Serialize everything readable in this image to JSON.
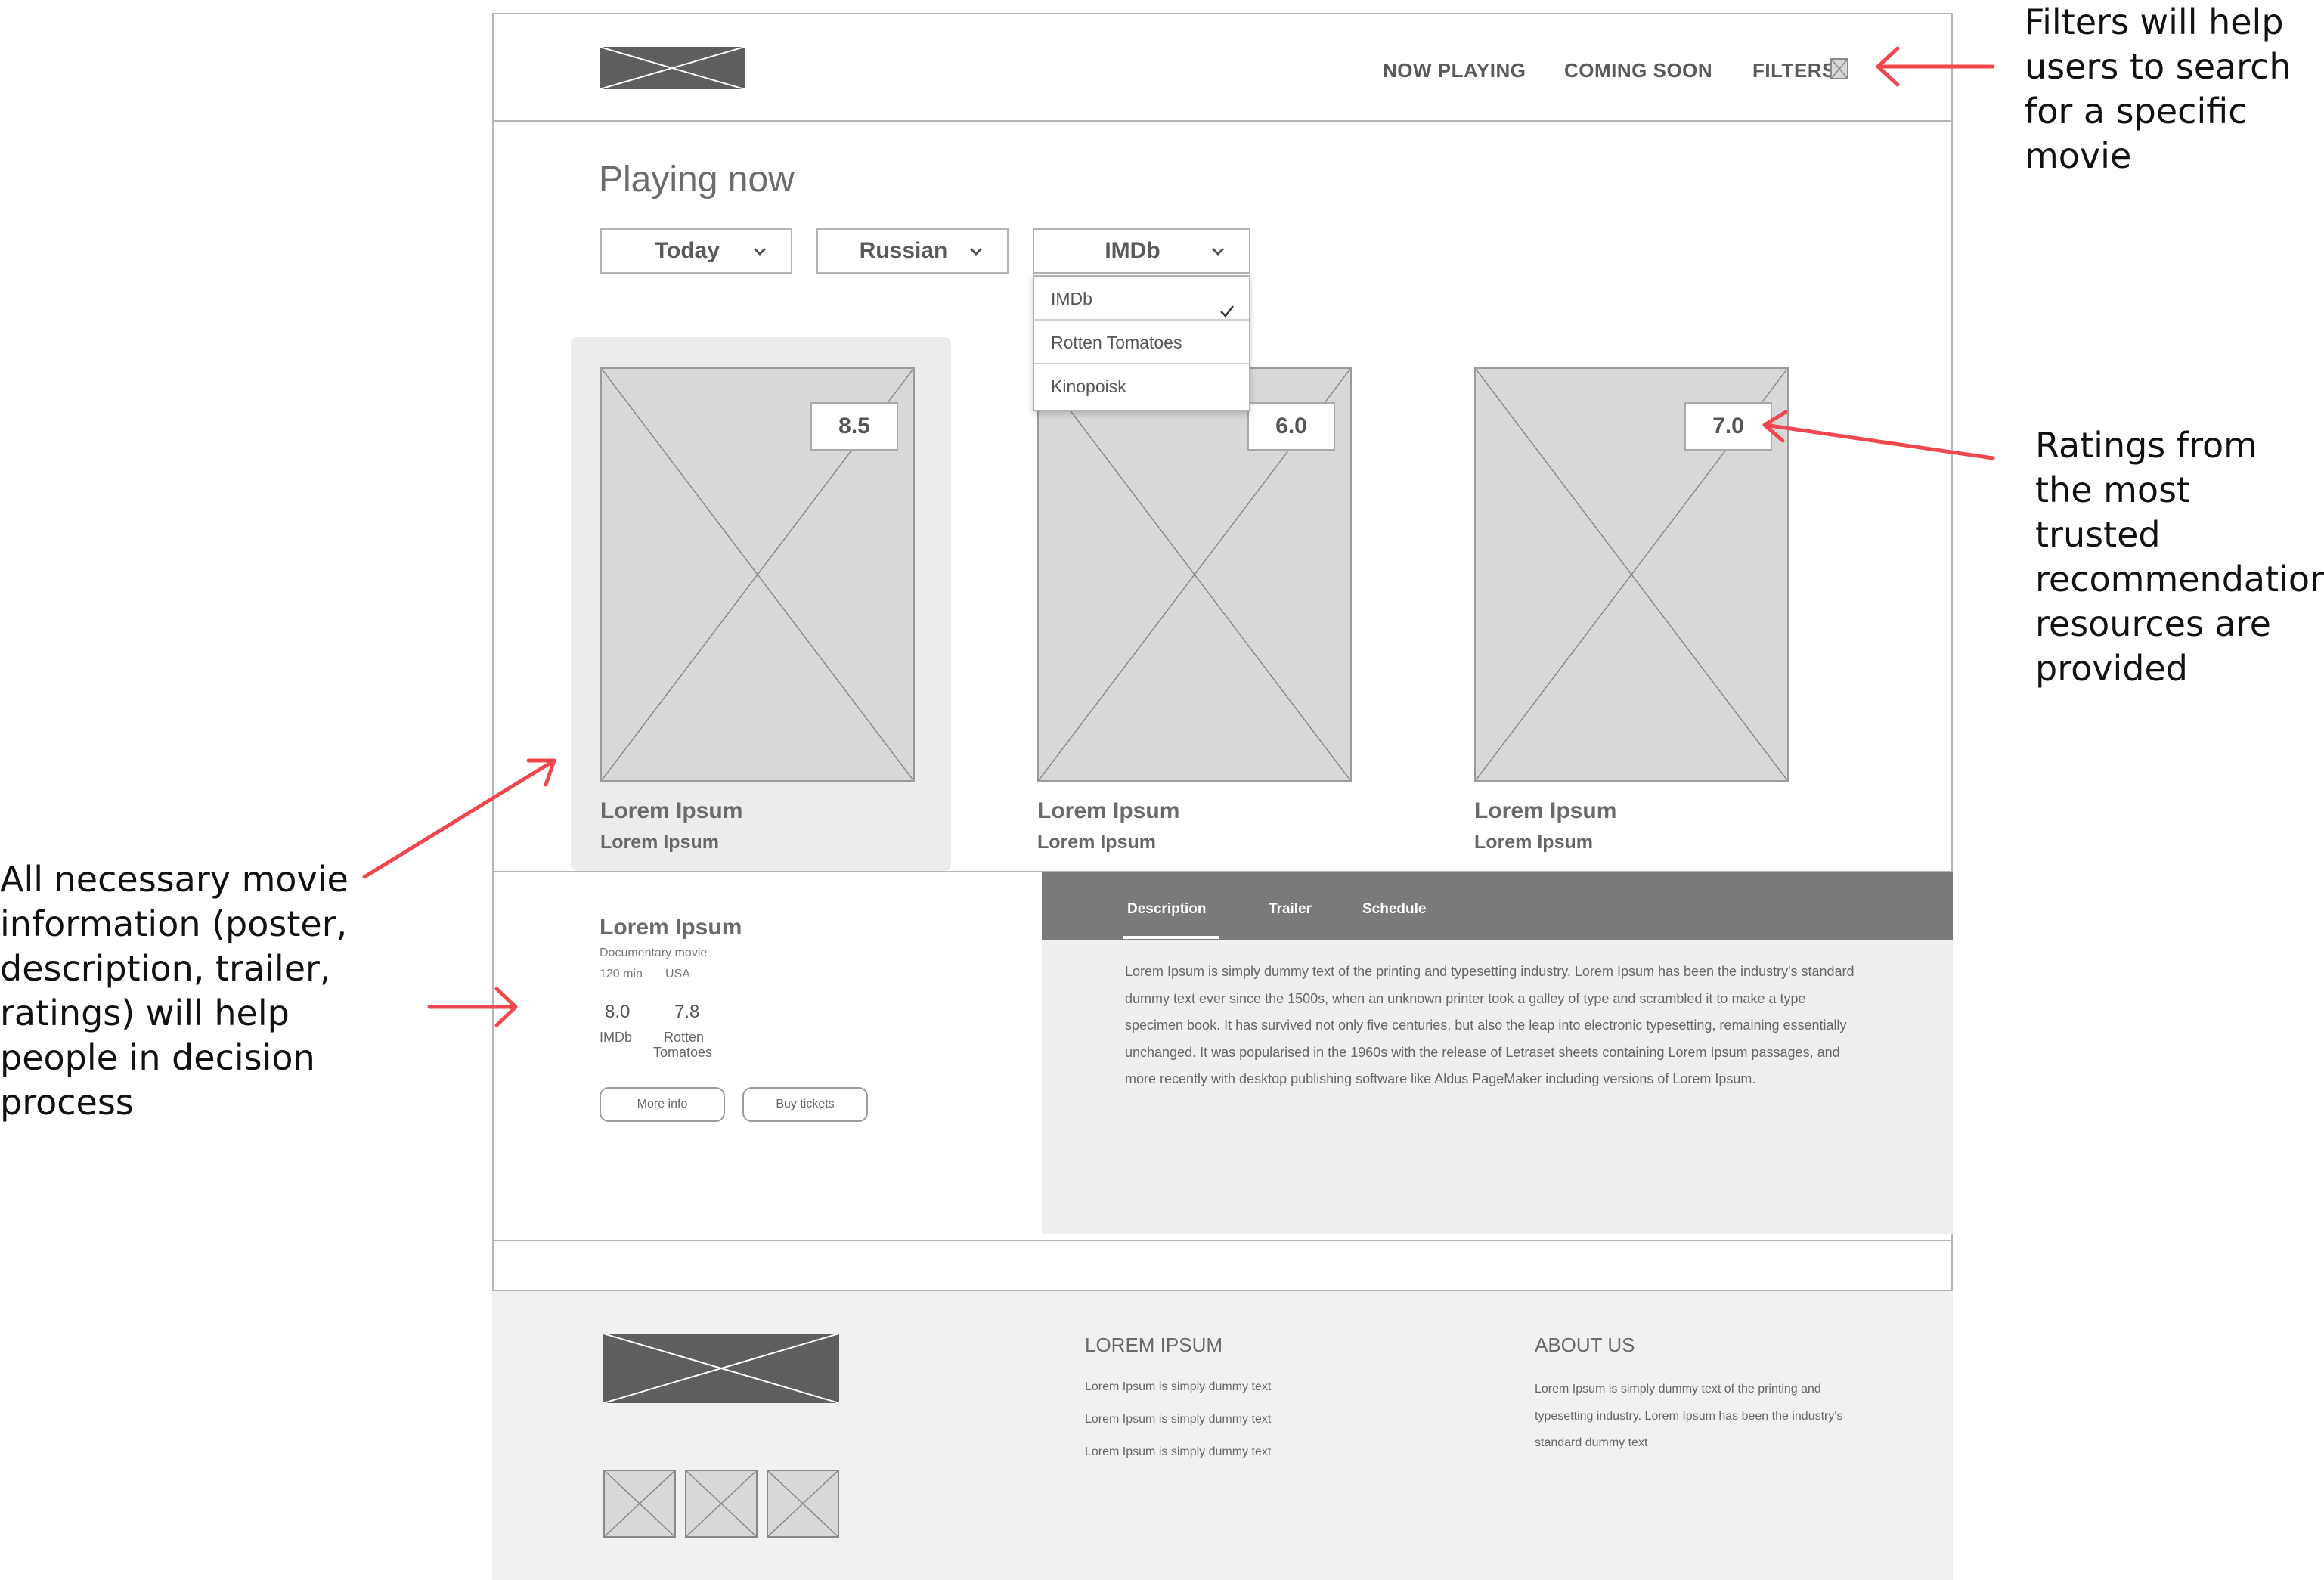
{
  "nav": {
    "now_playing": "NOW PLAYING",
    "coming_soon": "COMING SOON",
    "filters": "FILTERS"
  },
  "page_title": "Playing now",
  "dropdowns": {
    "date": "Today",
    "language": "Russian",
    "rating_source": "IMDb"
  },
  "rating_menu": {
    "options": [
      "IMDb",
      "Rotten Tomatoes",
      "Kinopoisk"
    ],
    "selected": "IMDb"
  },
  "movies": [
    {
      "title": "Lorem Ipsum",
      "subtitle": "Lorem Ipsum",
      "rating": "8.5"
    },
    {
      "title": "Lorem Ipsum",
      "subtitle": "Lorem Ipsum",
      "rating": "6.0"
    },
    {
      "title": "Lorem Ipsum",
      "subtitle": "Lorem Ipsum",
      "rating": "7.0"
    }
  ],
  "details": {
    "title": "Lorem Ipsum",
    "genre": "Documentary movie",
    "duration": "120 min",
    "country": "USA",
    "imdb_score": "8.0",
    "imdb_label": "IMDb",
    "rt_score": "7.8",
    "rt_label_1": "Rotten",
    "rt_label_2": "Tomatoes",
    "more_info": "More info",
    "buy_tickets": "Buy tickets"
  },
  "tabs": [
    "Description",
    "Trailer",
    "Schedule"
  ],
  "description": "Lorem Ipsum is simply dummy text of the printing and typesetting industry. Lorem Ipsum has been the industry's standard dummy text ever since the 1500s, when an unknown printer took a galley of type and scrambled it to make a type specimen book. It has survived not only five centuries, but also the leap into electronic typesetting, remaining essentially unchanged. It was popularised in the 1960s with the release of Letraset sheets containing Lorem Ipsum passages, and more recently with desktop publishing software like Aldus PageMaker including versions of Lorem Ipsum.",
  "footer": {
    "col1_heading": "LOREM IPSUM",
    "col1_links": [
      "Lorem Ipsum is simply dummy text",
      "Lorem Ipsum is simply dummy text",
      "Lorem Ipsum is simply dummy text"
    ],
    "col2_heading": "ABOUT US",
    "col2_text": "Lorem Ipsum is simply dummy text of the printing and typesetting industry. Lorem Ipsum has been the industry's standard dummy text"
  },
  "annotations": {
    "filters": "Filters will help users to search for a specific movie",
    "ratings": "Ratings from the most trusted recommendation resources are provided",
    "info": "All necessary movie information (poster, description, trailer, ratings) will help people in decision process"
  },
  "colors": {
    "annotation_arrow": "#f0474e",
    "tab_bar": "#7a7a7a",
    "placeholder": "#d8d8d8",
    "footer_bg": "#f1f1f1"
  }
}
